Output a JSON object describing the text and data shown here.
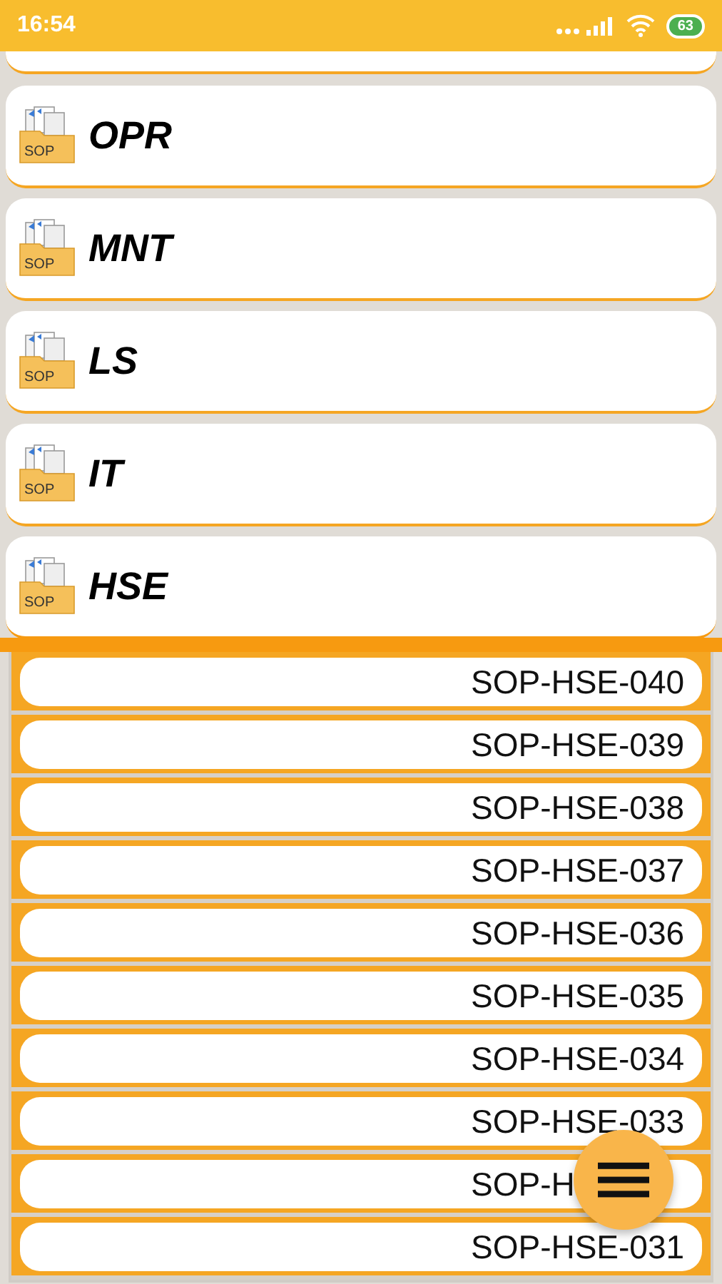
{
  "status_bar": {
    "time": "16:54",
    "battery": "63"
  },
  "categories": [
    {
      "label": "OPR",
      "icon_text": "SOP",
      "expanded": false
    },
    {
      "label": "MNT",
      "icon_text": "SOP",
      "expanded": false
    },
    {
      "label": "LS",
      "icon_text": "SOP",
      "expanded": false
    },
    {
      "label": "IT",
      "icon_text": "SOP",
      "expanded": false
    },
    {
      "label": "HSE",
      "icon_text": "SOP",
      "expanded": true,
      "items": [
        "SOP-HSE-040",
        "SOP-HSE-039",
        "SOP-HSE-038",
        "SOP-HSE-037",
        "SOP-HSE-036",
        "SOP-HSE-035",
        "SOP-HSE-034",
        "SOP-HSE-033",
        "SOP-H",
        "SOP-HSE-031"
      ]
    }
  ]
}
